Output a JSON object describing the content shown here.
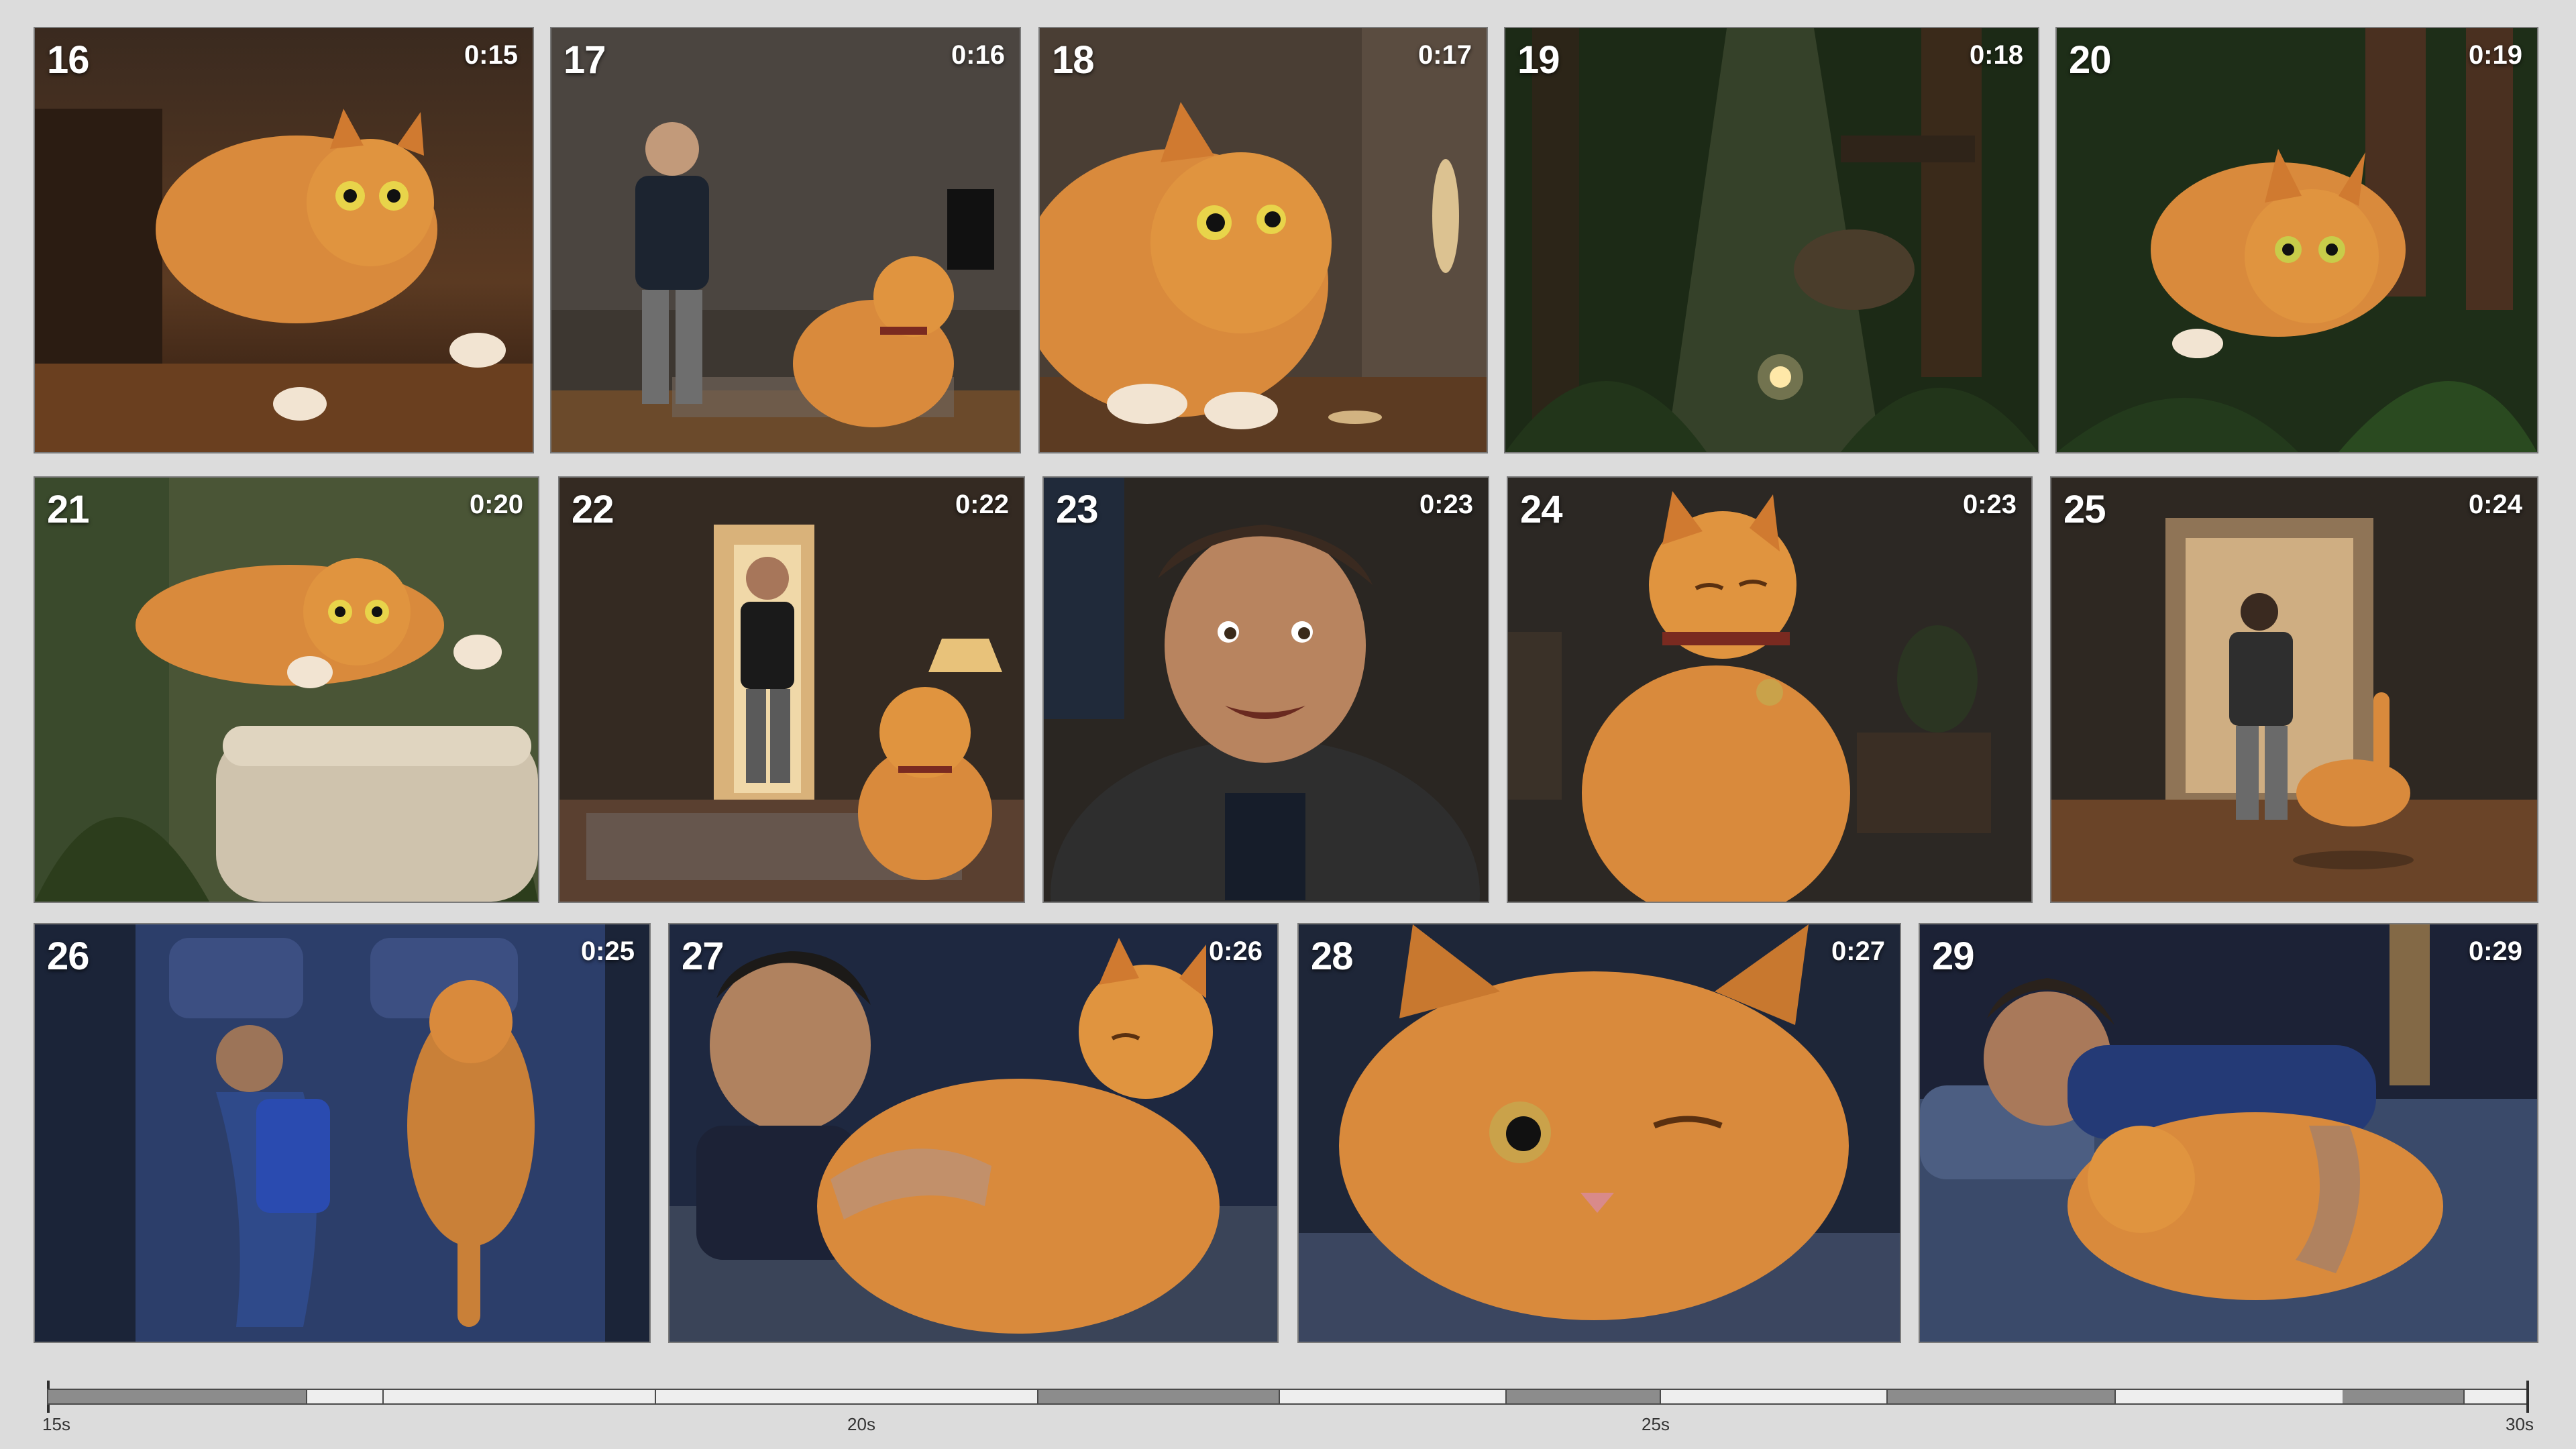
{
  "panels": [
    {
      "num": "16",
      "time": "0:15",
      "scene": "cat-pounce-hall"
    },
    {
      "num": "17",
      "time": "0:16",
      "scene": "man-and-cat-living-room"
    },
    {
      "num": "18",
      "time": "0:17",
      "scene": "cat-stares-at-light"
    },
    {
      "num": "19",
      "time": "0:18",
      "scene": "jungle-dot"
    },
    {
      "num": "20",
      "time": "0:19",
      "scene": "cat-prowls-jungle"
    },
    {
      "num": "21",
      "time": "0:20",
      "scene": "cat-leaps-to-couch"
    },
    {
      "num": "22",
      "time": "0:22",
      "scene": "man-in-doorway-cat-sits"
    },
    {
      "num": "23",
      "time": "0:23",
      "scene": "man-closeup-smile"
    },
    {
      "num": "24",
      "time": "0:23",
      "scene": "cat-proud-closeup"
    },
    {
      "num": "25",
      "time": "0:24",
      "scene": "cat-follows-man-hall"
    },
    {
      "num": "26",
      "time": "0:25",
      "scene": "bed-overhead-sleeping"
    },
    {
      "num": "27",
      "time": "0:26",
      "scene": "man-hugs-cat-bed"
    },
    {
      "num": "28",
      "time": "0:27",
      "scene": "cat-wink-closeup"
    },
    {
      "num": "29",
      "time": "0:29",
      "scene": "man-cuddles-cat-sleep"
    }
  ],
  "timeline": {
    "start_label": "15s",
    "ticks": [
      "15s",
      "20s",
      "25s",
      "30s"
    ],
    "colors": {
      "track": "#eeeeee",
      "segment": "#8c8c8c",
      "border": "#4a4a4a"
    }
  },
  "colors": {
    "background": "#dcdcdc",
    "cat": "#d98a3c",
    "night_blue": "#1f2d4d",
    "jungle": "#1c2a16"
  }
}
